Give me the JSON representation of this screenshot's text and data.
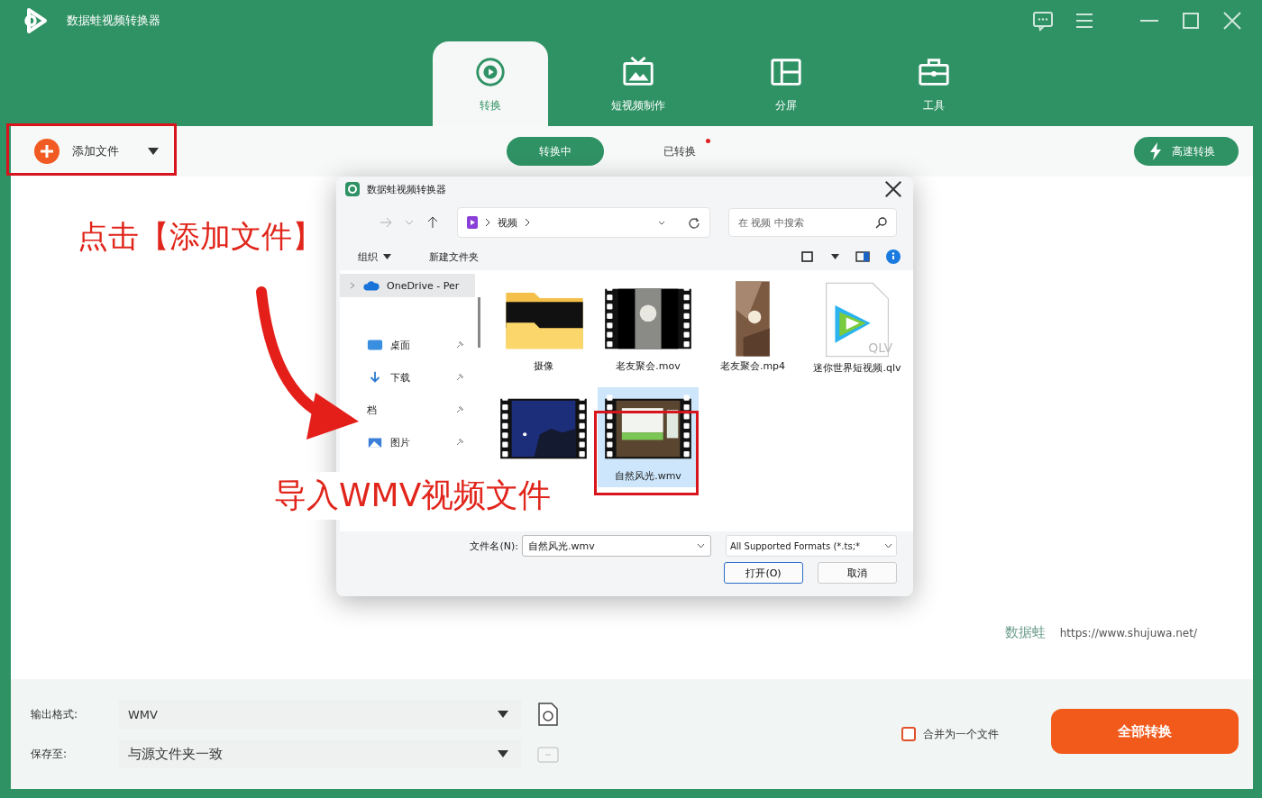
{
  "app": {
    "title": "数据蛙视频转换器"
  },
  "tabs": [
    {
      "label": "转换",
      "kind": "convert",
      "selected": true
    },
    {
      "label": "短视频制作",
      "kind": "tv",
      "selected": false
    },
    {
      "label": "分屏",
      "kind": "split",
      "selected": false
    },
    {
      "label": "工具",
      "kind": "toolbox",
      "selected": false
    }
  ],
  "add_file": {
    "label": "添加文件"
  },
  "subtabs": [
    {
      "label": "转换中",
      "selected": true,
      "dot": false
    },
    {
      "label": "已转换",
      "selected": false,
      "dot": true
    }
  ],
  "turbo_button": {
    "label": "高速转换"
  },
  "dialog": {
    "title": "数据蛙视频转换器",
    "breadcrumb": "视频",
    "search_placeholder": "在 视频 中搜索",
    "commands": [
      "组织",
      "新建文件夹"
    ],
    "nav": [
      {
        "label": "OneDrive - Per",
        "kind": "cloud",
        "selected": true
      },
      {
        "label": "桌面",
        "kind": "desktop",
        "selected": false
      },
      {
        "label": "下载",
        "kind": "download",
        "selected": false
      },
      {
        "label": "档",
        "kind": "document",
        "selected": false
      },
      {
        "label": "图片",
        "kind": "pictures",
        "selected": false
      }
    ],
    "files": [
      {
        "name": "摄像",
        "kind": "folder",
        "selected": false
      },
      {
        "name": "老友聚会.mov",
        "kind": "video",
        "selected": false
      },
      {
        "name": "老友聚会.mp4",
        "kind": "portrait",
        "selected": false
      },
      {
        "name": "迷你世界短视频.qlv",
        "kind": "qlv",
        "icon_text": "QLV",
        "selected": false
      },
      {
        "kind": "night",
        "selected": false
      },
      {
        "name": "自然风光.wmv",
        "kind": "landscape",
        "selected": true
      }
    ],
    "filename_label": "文件名(N):",
    "filename": "自然风光.wmv",
    "filter": "All Supported Formats (*.ts;*",
    "open_button": "打开(O)",
    "cancel_button": "取消"
  },
  "annotations": {
    "callout_1": "点击【添加文件】",
    "callout_2": "导入WMV视频文件"
  },
  "brand": {
    "logo_text": "数据蛙",
    "url": "https://www.shujuwa.net/"
  },
  "output": {
    "format_label": "输出格式:",
    "format": "WMV",
    "save_label": "保存至:",
    "save": "与源文件夹一致"
  },
  "merge": {
    "label": "合并为一个文件",
    "checked": false
  },
  "convert_all_button": {
    "label": "全部转换"
  }
}
